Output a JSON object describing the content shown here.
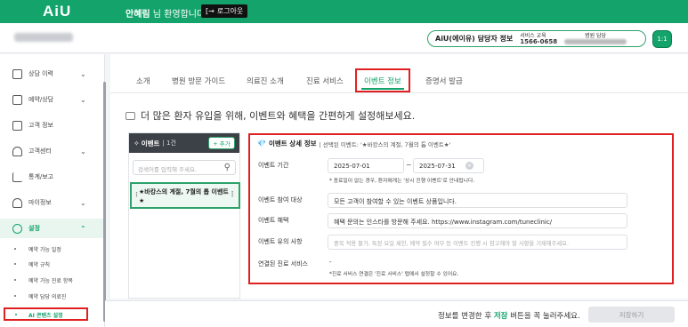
{
  "header": {
    "logo": "AiU",
    "user_name": "안혜림",
    "welcome_suffix": "님 환영합니다.",
    "logout_label": "로그아웃"
  },
  "subheader": {
    "manager_label": "AiU(에이유) 담당자 정보",
    "service_title": "서비스 교육",
    "service_phone": "1566-0658",
    "hospital_title": "병원 담당",
    "chat_label": "1:1"
  },
  "sidebar": {
    "items": [
      {
        "label": "상담 이력",
        "icon": "message-square-icon",
        "chevron": "⌄"
      },
      {
        "label": "예약/상담",
        "icon": "calendar-icon",
        "chevron": "⌄"
      },
      {
        "label": "고객 정보",
        "icon": "user-card-icon",
        "chevron": ""
      },
      {
        "label": "고객센터",
        "icon": "headset-icon",
        "chevron": "⌄"
      },
      {
        "label": "통계/보고",
        "icon": "chart-line-icon",
        "chevron": ""
      },
      {
        "label": "마이정보",
        "icon": "person-icon",
        "chevron": "⌄"
      },
      {
        "label": "설정",
        "icon": "gear-icon",
        "chevron": "⌃"
      }
    ],
    "subitems": [
      {
        "label": "예약 가능 일정"
      },
      {
        "label": "예약 규칙"
      },
      {
        "label": "예약 가능 진료 항목"
      },
      {
        "label": "예약 담당 의료진"
      },
      {
        "label": "AI 콘텐츠 설정"
      }
    ]
  },
  "tabs": [
    {
      "label": "소개"
    },
    {
      "label": "병원 방문 가이드"
    },
    {
      "label": "의료진 소개"
    },
    {
      "label": "진료 서비스"
    },
    {
      "label": "이벤트 정보"
    },
    {
      "label": "증명서 발급"
    }
  ],
  "tagline": "더 많은 환자 유입을 위해, 이벤트와 혜택을 간편하게 설정해보세요.",
  "event_list": {
    "title": "이벤트",
    "count": "| 1건",
    "add_label": "+ 추가",
    "search_placeholder": "검색어를 입력해 주세요.",
    "items": [
      {
        "label": "★바캉스의 계절, 7월의 톱 이벤트★"
      }
    ]
  },
  "detail": {
    "title": "이벤트 상세 정보",
    "selected_prefix": "| 선택된 이벤트: '★바캉스의 계절, 7월의 톱 이벤트★'",
    "period_label": "이벤트 기간",
    "start_date": "2025-07-01",
    "tilde": "~",
    "end_date": "2025-07-31",
    "period_note": "* 종료일이 없는 경우, 환자에게는 '상시 진행 이벤트'로 안내됩니다.",
    "target_label": "이벤트 참여 대상",
    "target_value": "모든 고객이 참여할 수 있는 이벤트 상품입니다.",
    "benefit_label": "이벤트 혜택",
    "benefit_value": "혜택 문의는 인스타를 방문해 주세요. https://www.instagram.com/tuneclinic/",
    "caution_label": "이벤트 유의 사항",
    "caution_placeholder": "중복 적용 불가, 특정 요일 제한, 예약 필수 여부 등 이벤트 진행 시 참고해야 할 사항을 기재해주세요.",
    "linked_label": "연결된 진료 서비스",
    "linked_value": "-",
    "linked_note": "*진료 서비스 연결은 '진료 서비스' 탭에서 설정할 수 있어요."
  },
  "footer": {
    "msg_prefix": "정보를 변경한 후 ",
    "msg_highlight": "저장",
    "msg_suffix": " 버튼을 꼭 눌러주세요.",
    "save_label": "저장하기"
  },
  "colors": {
    "brand": "#13a36b",
    "highlight_border": "#e02020",
    "list_header": "#3c4147"
  }
}
